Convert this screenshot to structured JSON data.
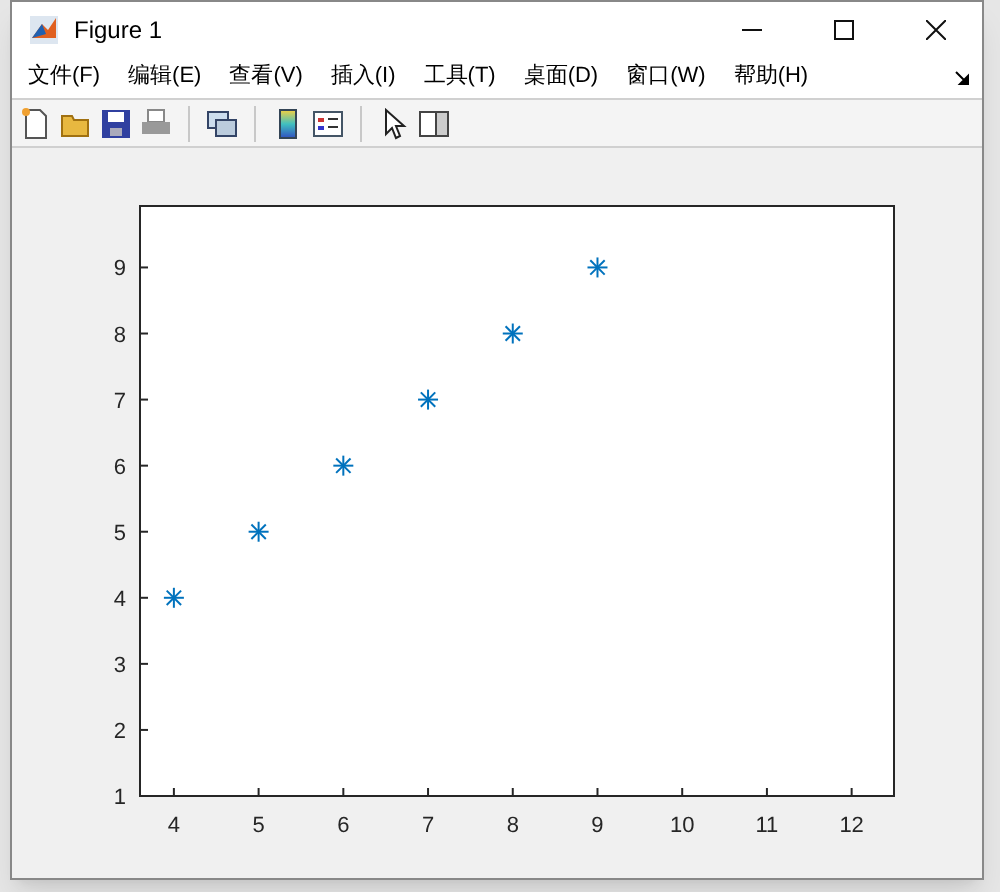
{
  "window": {
    "title": "Figure 1"
  },
  "menu": [
    {
      "label": "文件(F)"
    },
    {
      "label": "编辑(E)"
    },
    {
      "label": "查看(V)"
    },
    {
      "label": "插入(I)"
    },
    {
      "label": "工具(T)"
    },
    {
      "label": "桌面(D)"
    },
    {
      "label": "窗口(W)"
    },
    {
      "label": "帮助(H)"
    }
  ],
  "toolbar": [
    {
      "kind": "new"
    },
    {
      "kind": "open"
    },
    {
      "kind": "save"
    },
    {
      "kind": "print"
    },
    {
      "kind": "separator"
    },
    {
      "kind": "link"
    },
    {
      "kind": "separator"
    },
    {
      "kind": "colorbar"
    },
    {
      "kind": "legend"
    },
    {
      "kind": "separator"
    },
    {
      "kind": "pointer"
    },
    {
      "kind": "panel"
    }
  ],
  "chart_data": {
    "type": "scatter",
    "x": [
      4,
      5,
      6,
      7,
      8,
      9
    ],
    "series": [
      {
        "color": "#0072bd",
        "values": [
          4,
          5,
          6,
          7,
          8,
          9
        ]
      }
    ],
    "xlim": [
      3.6,
      12.5
    ],
    "ylim": [
      1,
      9.93
    ],
    "xticks": [
      {
        "value": 4,
        "label": "4"
      },
      {
        "value": 5,
        "label": "5"
      },
      {
        "value": 6,
        "label": "6"
      },
      {
        "value": 7,
        "label": "7"
      },
      {
        "value": 8,
        "label": "8"
      },
      {
        "value": 9,
        "label": "9"
      },
      {
        "value": 10,
        "label": "10"
      },
      {
        "value": 11,
        "label": "11"
      },
      {
        "value": 12,
        "label": "12"
      }
    ],
    "yticks": [
      {
        "value": 1,
        "label": "1"
      },
      {
        "value": 2,
        "label": "2"
      },
      {
        "value": 3,
        "label": "3"
      },
      {
        "value": 4,
        "label": "4"
      },
      {
        "value": 5,
        "label": "5"
      },
      {
        "value": 6,
        "label": "6"
      },
      {
        "value": 7,
        "label": "7"
      },
      {
        "value": 8,
        "label": "8"
      },
      {
        "value": 9,
        "label": "9"
      }
    ]
  }
}
